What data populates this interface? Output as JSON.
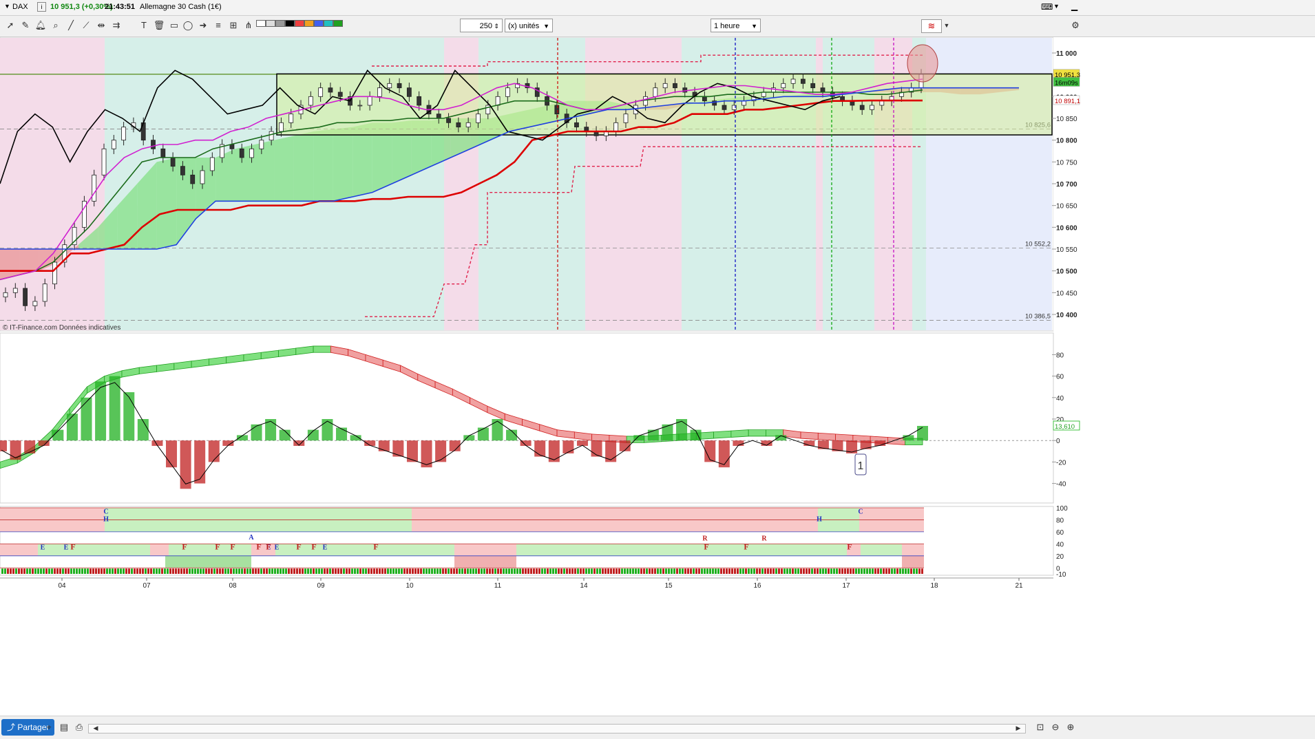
{
  "window": {
    "symbol": "DAX",
    "price_change": "10 951,3 (+0,30%)",
    "time": "21:43:51",
    "instrument": "Allemagne 30 Cash (1€)"
  },
  "toolbar": {
    "units_value": "250",
    "units_label": "(x) unités",
    "period": "1 heure"
  },
  "footer": {
    "share_label": "Partager"
  },
  "colors": {
    "up_candle": "#1a8c1a",
    "down_candle": "#c00000",
    "kijun": "#dd0000",
    "tenkan": "#1a6b1a",
    "chikou": "#000000",
    "ma_magenta": "#d020d0",
    "ma_blue": "#2040e0",
    "bg_pink": "#f4dce9",
    "bg_teal": "#d6efe9",
    "bg_yellow": "#f4f2c8",
    "bg_blue": "#e7ecfb"
  },
  "chart_data": [
    {
      "type": "candlestick",
      "title": "DAX",
      "source_note": "© IT-Finance.com  Données indicatives",
      "ylim": [
        10370,
        11030
      ],
      "y_ticks": [
        "11 000",
        "10 950",
        "10 900",
        "10 850",
        "10 800",
        "10 750",
        "10 700",
        "10 650",
        "10 600",
        "10 550",
        "10 500",
        "10 450",
        "10 400"
      ],
      "price_labels": [
        {
          "text": "10 951,3",
          "value": 10951.3,
          "style": "last"
        },
        {
          "text": "16m09s",
          "value": 10933,
          "style": "timer"
        },
        {
          "text": "10 891,1",
          "value": 10891.1,
          "style": "kijun"
        }
      ],
      "levels": [
        {
          "text": "10 825,6",
          "value": 10825.6
        },
        {
          "text": "10 552,2",
          "value": 10552.2
        },
        {
          "text": "10 386,5",
          "value": 10386.5
        }
      ],
      "x_ticks": [
        "04",
        "07",
        "08",
        "09",
        "10",
        "11",
        "14",
        "15",
        "16",
        "17",
        "18",
        "21"
      ],
      "series": [
        {
          "name": "Kijun",
          "values": [
            10500,
            10500,
            10500,
            10500,
            10540,
            10540,
            10550,
            10560,
            10600,
            10630,
            10640,
            10640,
            10640,
            10640,
            10650,
            10650,
            10650,
            10650,
            10660,
            10660,
            10660,
            10665,
            10665,
            10670,
            10670,
            10670,
            10680,
            10700,
            10720,
            10750,
            10800,
            10810,
            10820,
            10820,
            10820,
            10820,
            10830,
            10830,
            10840,
            10860,
            10860,
            10860,
            10870,
            10870,
            10875,
            10880,
            10885,
            10890,
            10890,
            10891,
            10891,
            10891,
            10891
          ]
        },
        {
          "name": "Tenkan",
          "values": [
            10480,
            10490,
            10500,
            10520,
            10560,
            10600,
            10650,
            10700,
            10750,
            10760,
            10760,
            10760,
            10780,
            10790,
            10800,
            10810,
            10820,
            10825,
            10830,
            10840,
            10840,
            10845,
            10845,
            10850,
            10850,
            10850,
            10860,
            10870,
            10880,
            10890,
            10890,
            10890,
            10880,
            10870,
            10870,
            10880,
            10890,
            10895,
            10900,
            10900,
            10900,
            10905,
            10905,
            10910,
            10910,
            10910,
            10910,
            10910,
            10910,
            10905,
            10905,
            10910,
            10915
          ]
        },
        {
          "name": "Chikou",
          "values": [
            10700,
            10820,
            10860,
            10830,
            10750,
            10820,
            10870,
            10850,
            10820,
            10920,
            10960,
            10940,
            10900,
            10860,
            10870,
            10880,
            10920,
            10880,
            10860,
            10900,
            10890,
            10960,
            10920,
            10900,
            10850,
            10880,
            10960,
            10920,
            10880,
            10820,
            10810,
            10800,
            10830,
            10860,
            10870,
            10900,
            10880,
            10850,
            10840,
            10880,
            10910,
            10930,
            10920,
            10900,
            10890,
            10880,
            10870,
            10890,
            10900
          ]
        },
        {
          "name": "MA magenta",
          "values": [
            10480,
            10490,
            10500,
            10540,
            10600,
            10660,
            10720,
            10760,
            10780,
            10790,
            10790,
            10800,
            10800,
            10820,
            10830,
            10850,
            10860,
            10870,
            10880,
            10890,
            10900,
            10900,
            10895,
            10880,
            10870,
            10870,
            10880,
            10900,
            10920,
            10930,
            10920,
            10900,
            10880,
            10870,
            10870,
            10880,
            10890,
            10900,
            10910,
            10915,
            10920,
            10925,
            10925,
            10920,
            10915,
            10910,
            10905,
            10905,
            10910,
            10920,
            10930,
            10935,
            10940
          ]
        },
        {
          "name": "MA blue",
          "values": [
            10550,
            10550,
            10550,
            10550,
            10550,
            10550,
            10550,
            10550,
            10550,
            10560,
            10620,
            10660,
            10660,
            10660,
            10660,
            10660,
            10660,
            10660,
            10670,
            10680,
            10700,
            10720,
            10740,
            10760,
            10780,
            10800,
            10820,
            10830,
            10840,
            10850,
            10860,
            10870,
            10870,
            10875,
            10880,
            10885,
            10885,
            10890,
            10890,
            10895,
            10900,
            10900,
            10900,
            10905,
            10910,
            10915,
            10920,
            10920,
            10920,
            10920,
            10920,
            10920,
            10920
          ]
        }
      ],
      "candles_close": [
        10450,
        10460,
        10420,
        10430,
        10470,
        10520,
        10560,
        10600,
        10660,
        10720,
        10780,
        10800,
        10830,
        10840,
        10800,
        10780,
        10760,
        10740,
        10720,
        10700,
        10730,
        10760,
        10790,
        10780,
        10760,
        10780,
        10800,
        10820,
        10840,
        10860,
        10880,
        10900,
        10920,
        10910,
        10900,
        10880,
        10880,
        10900,
        10920,
        10930,
        10920,
        10900,
        10880,
        10860,
        10850,
        10840,
        10830,
        10840,
        10860,
        10880,
        10900,
        10920,
        10930,
        10920,
        10900,
        10880,
        10860,
        10840,
        10830,
        10820,
        10810,
        10820,
        10840,
        10860,
        10880,
        10900,
        10920,
        10930,
        10920,
        10910,
        10900,
        10890,
        10880,
        10870,
        10880,
        10890,
        10900,
        10910,
        10920,
        10930,
        10940,
        10930,
        10920,
        10910,
        10900,
        10890,
        10880,
        10870,
        10880,
        10890,
        10900,
        10910,
        10920,
        10951
      ]
    },
    {
      "type": "area",
      "title": "Oscillator",
      "ylim": [
        -55,
        95
      ],
      "y_ticks": [
        "80",
        "60",
        "40",
        "20",
        "0",
        "-20",
        "-40"
      ],
      "last_value_label": "13,610",
      "annotation": "1",
      "series": [
        {
          "name": "Histogram",
          "values": [
            -10,
            -18,
            -12,
            -5,
            10,
            25,
            40,
            55,
            60,
            45,
            20,
            -5,
            -25,
            -45,
            -40,
            -20,
            -5,
            5,
            15,
            20,
            10,
            -5,
            10,
            20,
            12,
            5,
            -5,
            -10,
            -15,
            -20,
            -25,
            -20,
            -10,
            5,
            12,
            20,
            10,
            -5,
            -15,
            -20,
            -12,
            -5,
            -15,
            -20,
            -10,
            5,
            10,
            15,
            20,
            10,
            -20,
            -25,
            -5,
            0,
            -5,
            5,
            0,
            -5,
            -8,
            -10,
            -12,
            -8,
            -5,
            0,
            5,
            13.6
          ]
        },
        {
          "name": "Slow line",
          "values": [
            -20,
            -15,
            -5,
            10,
            30,
            50,
            60,
            65,
            68,
            70,
            72,
            74,
            76,
            78,
            80,
            82,
            84,
            86,
            88,
            88,
            85,
            80,
            75,
            70,
            62,
            55,
            48,
            40,
            32,
            25,
            20,
            15,
            10,
            8,
            6,
            5,
            4,
            4,
            5,
            6,
            7,
            8,
            9,
            10,
            10,
            10,
            8,
            7,
            6,
            5,
            4,
            3,
            2,
            2
          ]
        }
      ]
    },
    {
      "type": "heatmap",
      "title": "Signals",
      "ylim": [
        -10,
        100
      ],
      "y_ticks": [
        "100",
        "80",
        "60",
        "40",
        "20",
        "0",
        "-10"
      ],
      "letters": [
        "C",
        "H",
        "A",
        "C",
        "H",
        "E",
        "F",
        "E",
        "F",
        "F",
        "F",
        "F",
        "F",
        "F",
        "E",
        "F",
        "E",
        "F",
        "F",
        "E",
        "F",
        "R",
        "R",
        "F"
      ]
    }
  ]
}
